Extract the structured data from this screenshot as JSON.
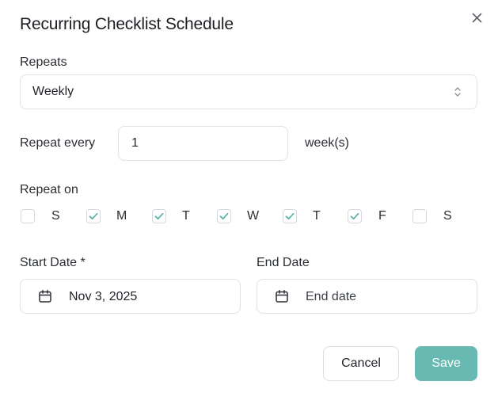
{
  "dialog": {
    "title": "Recurring Checklist Schedule"
  },
  "repeats": {
    "label": "Repeats",
    "selected": "Weekly"
  },
  "repeat_every": {
    "label": "Repeat every",
    "value": "1",
    "unit": "week(s)"
  },
  "repeat_on": {
    "label": "Repeat on",
    "days": [
      {
        "label": "S",
        "checked": false
      },
      {
        "label": "M",
        "checked": true
      },
      {
        "label": "T",
        "checked": true
      },
      {
        "label": "W",
        "checked": true
      },
      {
        "label": "T",
        "checked": true
      },
      {
        "label": "F",
        "checked": true
      },
      {
        "label": "S",
        "checked": false
      }
    ]
  },
  "start_date": {
    "label": "Start Date *",
    "value": "Nov 3, 2025"
  },
  "end_date": {
    "label": "End Date",
    "placeholder": "End date"
  },
  "actions": {
    "cancel_label": "Cancel",
    "save_label": "Save"
  },
  "colors": {
    "accent": "#67b9b1",
    "check": "#5cb3aa"
  },
  "icons": {
    "close": "close-icon",
    "select": "chevron-up-down-icon",
    "calendar": "calendar-icon",
    "check": "check-icon"
  }
}
